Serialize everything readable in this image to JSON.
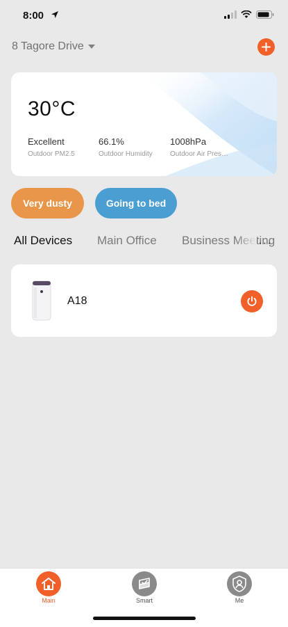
{
  "status_bar": {
    "time": "8:00"
  },
  "header": {
    "home_name": "8 Tagore Drive"
  },
  "weather": {
    "temperature": "30°C",
    "metrics": [
      {
        "value": "Excellent",
        "label": "Outdoor PM2.5"
      },
      {
        "value": "66.1%",
        "label": "Outdoor Humidity"
      },
      {
        "value": "1008hPa",
        "label": "Outdoor Air Pressure"
      }
    ]
  },
  "scenes": [
    {
      "label": "Very dusty",
      "color": "#e8974a"
    },
    {
      "label": "Going to bed",
      "color": "#4b9ed2"
    }
  ],
  "room_tabs": {
    "items": [
      "All Devices",
      "Main Office",
      "Business Meeting"
    ],
    "active": "All Devices",
    "more": "···"
  },
  "devices": [
    {
      "name": "A18",
      "icon": "air-purifier-icon",
      "power_color": "#f2602a"
    }
  ],
  "tab_bar": {
    "items": [
      {
        "label": "Main",
        "icon": "home-icon",
        "active": true
      },
      {
        "label": "Smart",
        "icon": "smart-icon",
        "active": false
      },
      {
        "label": "Me",
        "icon": "profile-icon",
        "active": false
      }
    ],
    "active_color": "#f2602a"
  },
  "colors": {
    "accent": "#f2602a",
    "background": "#e9e9e9"
  }
}
